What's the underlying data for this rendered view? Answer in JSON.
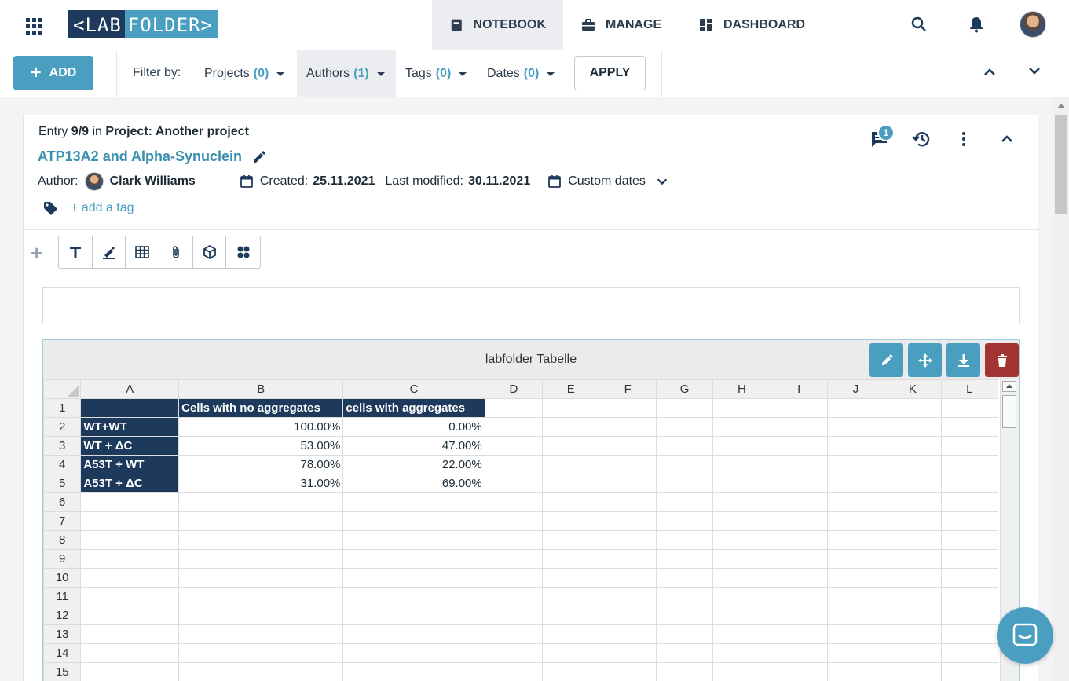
{
  "logo": {
    "lab": "<LAB",
    "folder": "FOLDER>"
  },
  "nav": {
    "notebook": "NOTEBOOK",
    "manage": "MANAGE",
    "dashboard": "DASHBOARD"
  },
  "filterbar": {
    "add_label": "ADD",
    "filter_by": "Filter by:",
    "projects": {
      "label": "Projects",
      "count": "(0)"
    },
    "authors": {
      "label": "Authors",
      "count": "(1)"
    },
    "tags": {
      "label": "Tags",
      "count": "(0)"
    },
    "dates": {
      "label": "Dates",
      "count": "(0)"
    },
    "apply": "APPLY"
  },
  "entry": {
    "entry_prefix": "Entry",
    "entry_index": "9/9",
    "in": "in",
    "project": "Project: Another project",
    "title": "ATP13A2 and Alpha-Synuclein",
    "author_label": "Author:",
    "author_name": "Clark Williams",
    "created_label": "Created:",
    "created_date": "25.11.2021",
    "modified_label": "Last modified:",
    "modified_date": "30.11.2021",
    "custom_dates": "Custom dates",
    "add_tag": "+ add a tag",
    "comment_count": "1"
  },
  "table_block": {
    "title": "labfolder Tabelle",
    "columns": [
      "A",
      "B",
      "C",
      "D",
      "E",
      "F",
      "G",
      "H",
      "I",
      "J",
      "K",
      "L"
    ],
    "rows": [
      {
        "n": "1",
        "cells": [
          "",
          "Cells with no aggregates",
          "cells with aggregates"
        ]
      },
      {
        "n": "2",
        "cells": [
          "WT+WT",
          "100.00%",
          "0.00%"
        ]
      },
      {
        "n": "3",
        "cells": [
          "WT + ΔC",
          "53.00%",
          "47.00%"
        ]
      },
      {
        "n": "4",
        "cells": [
          "A53T + WT",
          "78.00%",
          "22.00%"
        ]
      },
      {
        "n": "5",
        "cells": [
          "A53T + ΔC",
          "31.00%",
          "69.00%"
        ]
      },
      {
        "n": "6",
        "cells": [
          "",
          "",
          ""
        ]
      },
      {
        "n": "7",
        "cells": [
          "",
          "",
          ""
        ]
      },
      {
        "n": "8",
        "cells": [
          "",
          "",
          ""
        ]
      },
      {
        "n": "9",
        "cells": [
          "",
          "",
          ""
        ]
      },
      {
        "n": "10",
        "cells": [
          "",
          "",
          ""
        ]
      },
      {
        "n": "11",
        "cells": [
          "",
          "",
          ""
        ]
      },
      {
        "n": "12",
        "cells": [
          "",
          "",
          ""
        ]
      },
      {
        "n": "13",
        "cells": [
          "",
          "",
          ""
        ]
      },
      {
        "n": "14",
        "cells": [
          "",
          "",
          ""
        ]
      },
      {
        "n": "15",
        "cells": [
          "",
          "",
          ""
        ]
      }
    ]
  },
  "icons": {
    "apps": "apps-grid-icon",
    "search": "search-icon",
    "bell": "bell-icon",
    "comments": "comment-icon",
    "history": "history-icon",
    "more": "more-vertical-icon",
    "collapse": "chevron-up-icon",
    "edit": "pencil-icon",
    "move": "move-icon",
    "download": "download-icon",
    "delete": "trash-icon",
    "chat": "chat-icon"
  },
  "colors": {
    "brand_dark": "#1d3a5c",
    "accent": "#4a9fc1",
    "danger": "#a23434"
  }
}
